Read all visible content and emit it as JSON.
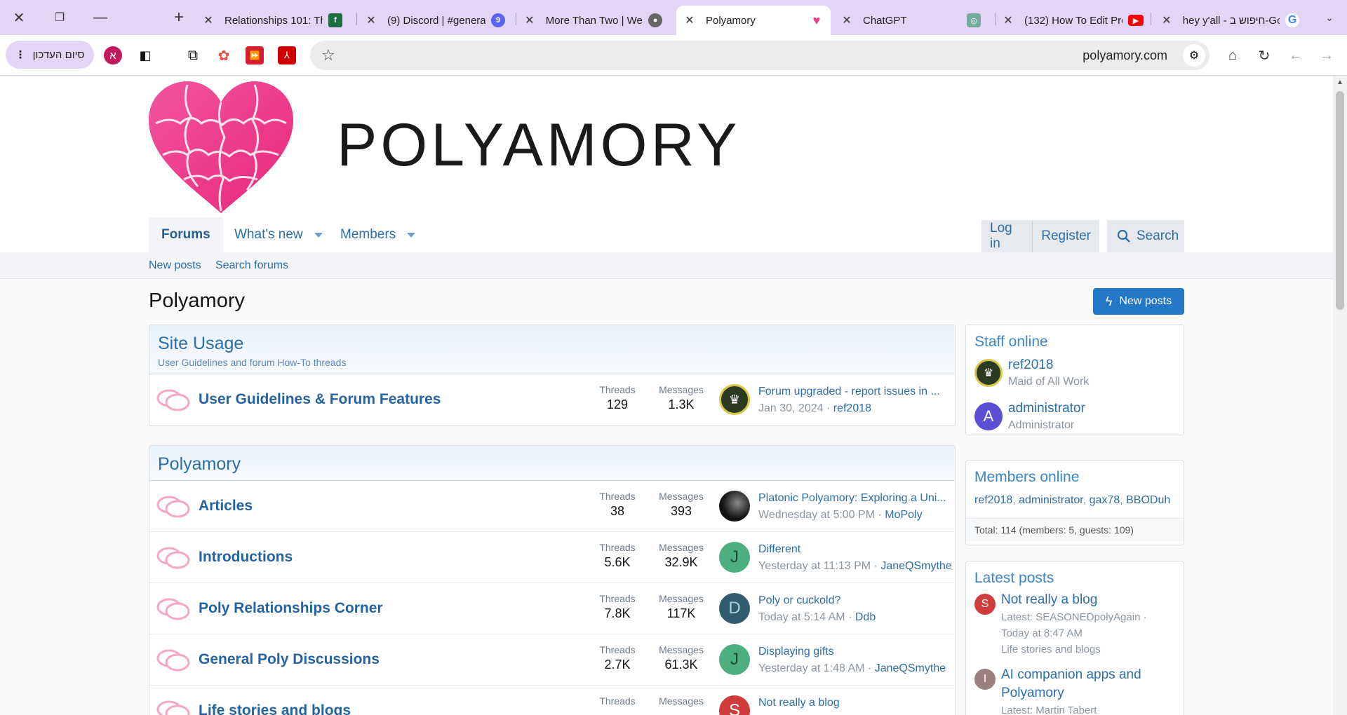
{
  "browser": {
    "tabs": [
      {
        "title": "Relationships 101: Th",
        "favicon": "f"
      },
      {
        "title": "(9) Discord | #genera",
        "favicon": "9"
      },
      {
        "title": "More Than Two | We",
        "favicon": "globe"
      },
      {
        "title": "Polyamory",
        "favicon": "heart",
        "active": true
      },
      {
        "title": "ChatGPT",
        "favicon": "chatgpt"
      },
      {
        "title": "(132) How To Edit Pro",
        "favicon": "youtube"
      },
      {
        "title": "hey y'all - חיפוש ב-Go",
        "favicon": "G"
      }
    ],
    "profile_label": "סיום העדכון",
    "profile_initial": "א",
    "url": "polyamory.com"
  },
  "site": {
    "logo_text": "POLYAMORY",
    "nav": {
      "forums": "Forums",
      "whats_new": "What's new",
      "members": "Members"
    },
    "auth": {
      "login": "Log in",
      "register": "Register",
      "search": "Search"
    },
    "subnav": {
      "new_posts": "New posts",
      "search_forums": "Search forums"
    },
    "page_title": "Polyamory",
    "new_posts_button": "New posts"
  },
  "categories": [
    {
      "title": "Site Usage",
      "description": "User Guidelines and forum How-To threads",
      "forums": [
        {
          "name": "User Guidelines & Forum Features",
          "threads": "129",
          "messages": "1.3K",
          "last_title": "Forum upgraded - report issues in ...",
          "last_date": "Jan 30, 2024",
          "last_user": "ref2018",
          "avatar": "",
          "avatar_color": "#2d3a22"
        }
      ]
    },
    {
      "title": "Polyamory",
      "description": "",
      "forums": [
        {
          "name": "Articles",
          "threads": "38",
          "messages": "393",
          "last_title": "Platonic Polyamory: Exploring a Uni...",
          "last_date": "Wednesday at 5:00 PM",
          "last_user": "MoPoly",
          "avatar": "",
          "avatar_color": "#1a1a1a"
        },
        {
          "name": "Introductions",
          "threads": "5.6K",
          "messages": "32.9K",
          "last_title": "Different",
          "last_date": "Yesterday at 11:13 PM",
          "last_user": "JaneQSmythe",
          "avatar": "J",
          "avatar_color": "#4caf7d"
        },
        {
          "name": "Poly Relationships Corner",
          "threads": "7.8K",
          "messages": "117K",
          "last_title": "Poly or cuckold?",
          "last_date": "Today at 5:14 AM",
          "last_user": "Ddb",
          "avatar": "D",
          "avatar_color": "#2f5d6e"
        },
        {
          "name": "General Poly Discussions",
          "threads": "2.7K",
          "messages": "61.3K",
          "last_title": "Displaying gifts",
          "last_date": "Yesterday at 1:48 AM",
          "last_user": "JaneQSmythe",
          "avatar": "J",
          "avatar_color": "#4caf7d"
        },
        {
          "name": "Life stories and blogs",
          "threads": "",
          "messages": "",
          "last_title": "Not really a blog",
          "last_date": "",
          "last_user": "",
          "avatar": "S",
          "avatar_color": "#d03b3b"
        }
      ]
    }
  ],
  "labels": {
    "threads": "Threads",
    "messages": "Messages"
  },
  "sidebar": {
    "staff_title": "Staff online",
    "staff": [
      {
        "name": "ref2018",
        "role": "Maid of All Work",
        "avatar": "",
        "color": "#2d3a22"
      },
      {
        "name": "administrator",
        "role": "Administrator",
        "avatar": "A",
        "color": "#5b4fd6"
      }
    ],
    "members_title": "Members online",
    "members_online": [
      "ref2018",
      "administrator",
      "gax78",
      "BBODuh"
    ],
    "members_total": "Total: 114 (members: 5, guests: 109)",
    "latest_title": "Latest posts",
    "latest": [
      {
        "title": "Not really a blog",
        "meta1": "Latest: SEASONEDpolyAgain ·",
        "meta2": "Today at 8:47 AM",
        "meta3": "Life stories and blogs",
        "avatar": "S",
        "color": "#d03b3b"
      },
      {
        "title": "AI companion apps and Polyamory",
        "meta1": "Latest: Martin Tabert",
        "meta2": "",
        "meta3": "",
        "avatar": "I",
        "color": "#9c7f7f"
      }
    ]
  }
}
